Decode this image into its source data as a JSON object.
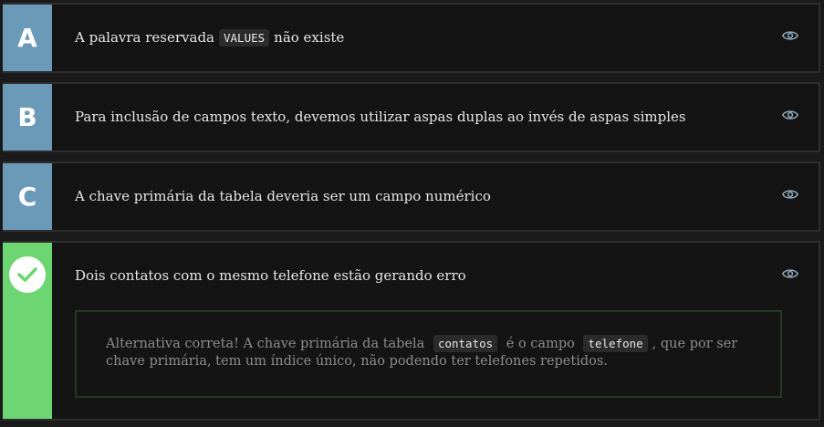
{
  "alternatives": [
    {
      "letter": "A",
      "text_before": "A palavra reservada",
      "code": "VALUES",
      "text_after": "não existe"
    },
    {
      "letter": "B",
      "text": "Para inclusão de campos texto, devemos utilizar aspas duplas ao invés de aspas simples"
    },
    {
      "letter": "C",
      "text": "A chave primária da tabela deveria ser um campo numérico"
    },
    {
      "text": "Dois contatos com o mesmo telefone estão gerando erro",
      "explanation": {
        "part1": "Alternativa correta! A chave primária da tabela",
        "code1": "contatos",
        "part2": "é o campo",
        "code2": "telefone",
        "part3": ", que por ser chave primária, tem um índice único, não podendo ter telefones repetidos."
      }
    }
  ],
  "colors": {
    "letter_bg": "#6a9ab8",
    "correct_bg": "#6dd672",
    "card_bg": "#141414",
    "eye_icon": "#8fa9bd"
  },
  "icons": {
    "eye": "eye-icon",
    "check": "check-icon"
  }
}
